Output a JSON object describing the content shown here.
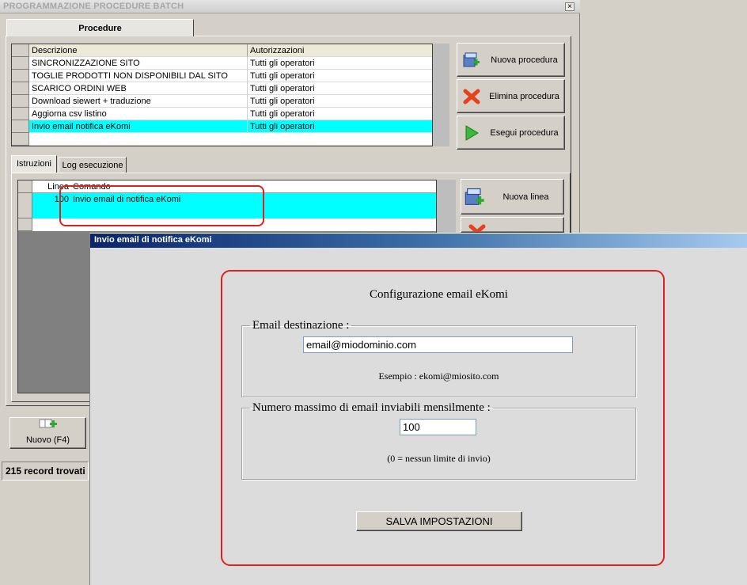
{
  "back_window": {
    "title": "PROGRAMMAZIONE PROCEDURE BATCH",
    "close_glyph": "×",
    "main_tab": "Procedure",
    "procedures_grid": {
      "columns": [
        "Descrizione",
        "Autorizzazioni"
      ],
      "rows": [
        {
          "description": "SINCRONIZZAZIONE SITO",
          "authorizations": "Tutti gli operatori"
        },
        {
          "description": "TOGLIE PRODOTTI NON DISPONIBILI DAL SITO",
          "authorizations": "Tutti gli operatori"
        },
        {
          "description": "SCARICO ORDINI WEB",
          "authorizations": "Tutti gli operatori"
        },
        {
          "description": "Download siewert + traduzione",
          "authorizations": "Tutti gli operatori"
        },
        {
          "description": "Aggiorna csv listino",
          "authorizations": "Tutti gli operatori"
        },
        {
          "description": "Invio email notifica eKomi",
          "authorizations": "Tutti gli operatori"
        }
      ],
      "selected_row_index": 5
    },
    "buttons": {
      "new_procedure": "Nuova procedura",
      "delete_procedure": "Elimina procedura",
      "run_procedure": "Esegui procedura",
      "new_line": "Nuova linea"
    },
    "lower_tabs": [
      "Istruzioni",
      "Log esecuzione"
    ],
    "lines_grid": {
      "columns": [
        "Linea",
        "Comando"
      ],
      "rows": [
        {
          "line": "100",
          "command": "Invio email di notifica eKomi"
        }
      ]
    },
    "new_button": "Nuovo (F4)",
    "records_found": "215 record trovati"
  },
  "dialog": {
    "title": "Invio email di notifica eKomi",
    "heading": "Configurazione email eKomi",
    "email_group": {
      "legend": "Email destinazione :",
      "value": "email@miodominio.com",
      "example": "Esempio : ekomi@miosito.com"
    },
    "max_group": {
      "legend": "Numero massimo di email inviabili mensilmente :",
      "value": "100",
      "hint": "(0 = nessun limite di invio)"
    },
    "save_button": "SALVA IMPOSTAZIONI"
  },
  "colors": {
    "selection": "#00ffff",
    "highlight_border": "#e02020",
    "dialog_title_bg": "#0a246a"
  }
}
